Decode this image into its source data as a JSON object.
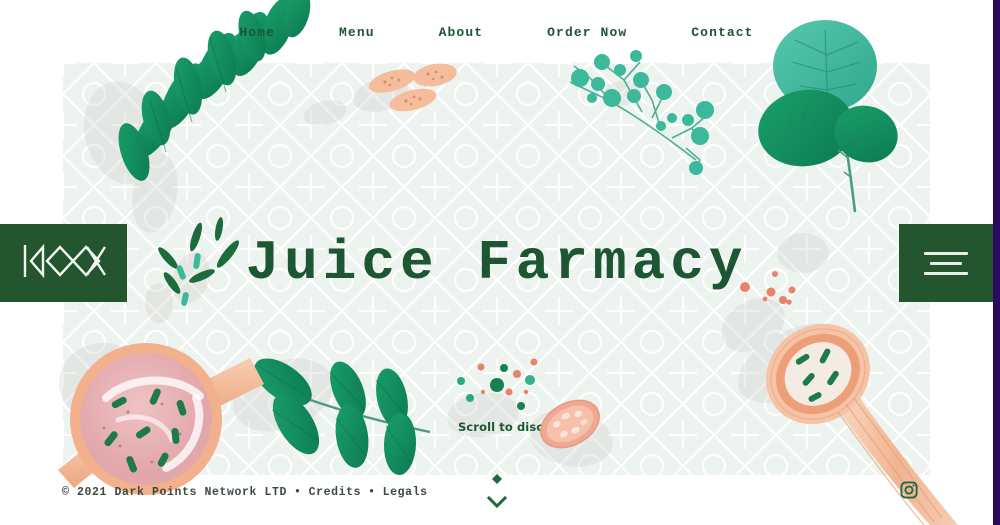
{
  "site": {
    "brand_name": "Juice Farmacy",
    "logo_text": "K◇◇X",
    "accent_green": "#1d5632",
    "logo_bg": "#23552f",
    "hero_bg": "#edf3ee",
    "leaf_dark": "#17905f",
    "leaf_teal": "#3cb89a",
    "peach": "#f3b391",
    "coral": "#e8826a",
    "scrollbar_color": "#2b0a5e"
  },
  "nav": {
    "items": [
      {
        "label": "Home"
      },
      {
        "label": "Menu"
      },
      {
        "label": "About"
      },
      {
        "label": "Order Now"
      },
      {
        "label": "Contact"
      }
    ]
  },
  "hero": {
    "title": "Juice Farmacy",
    "scroll_hint": "Scroll to discover"
  },
  "menu_button": {
    "label": "Open menu"
  },
  "footer": {
    "copyright": "© 2021 Dark Points Network LTD",
    "sep1": "•",
    "credits": "Credits",
    "sep2": "•",
    "legals": "Legals"
  },
  "social": {
    "instagram_label": "Instagram"
  }
}
